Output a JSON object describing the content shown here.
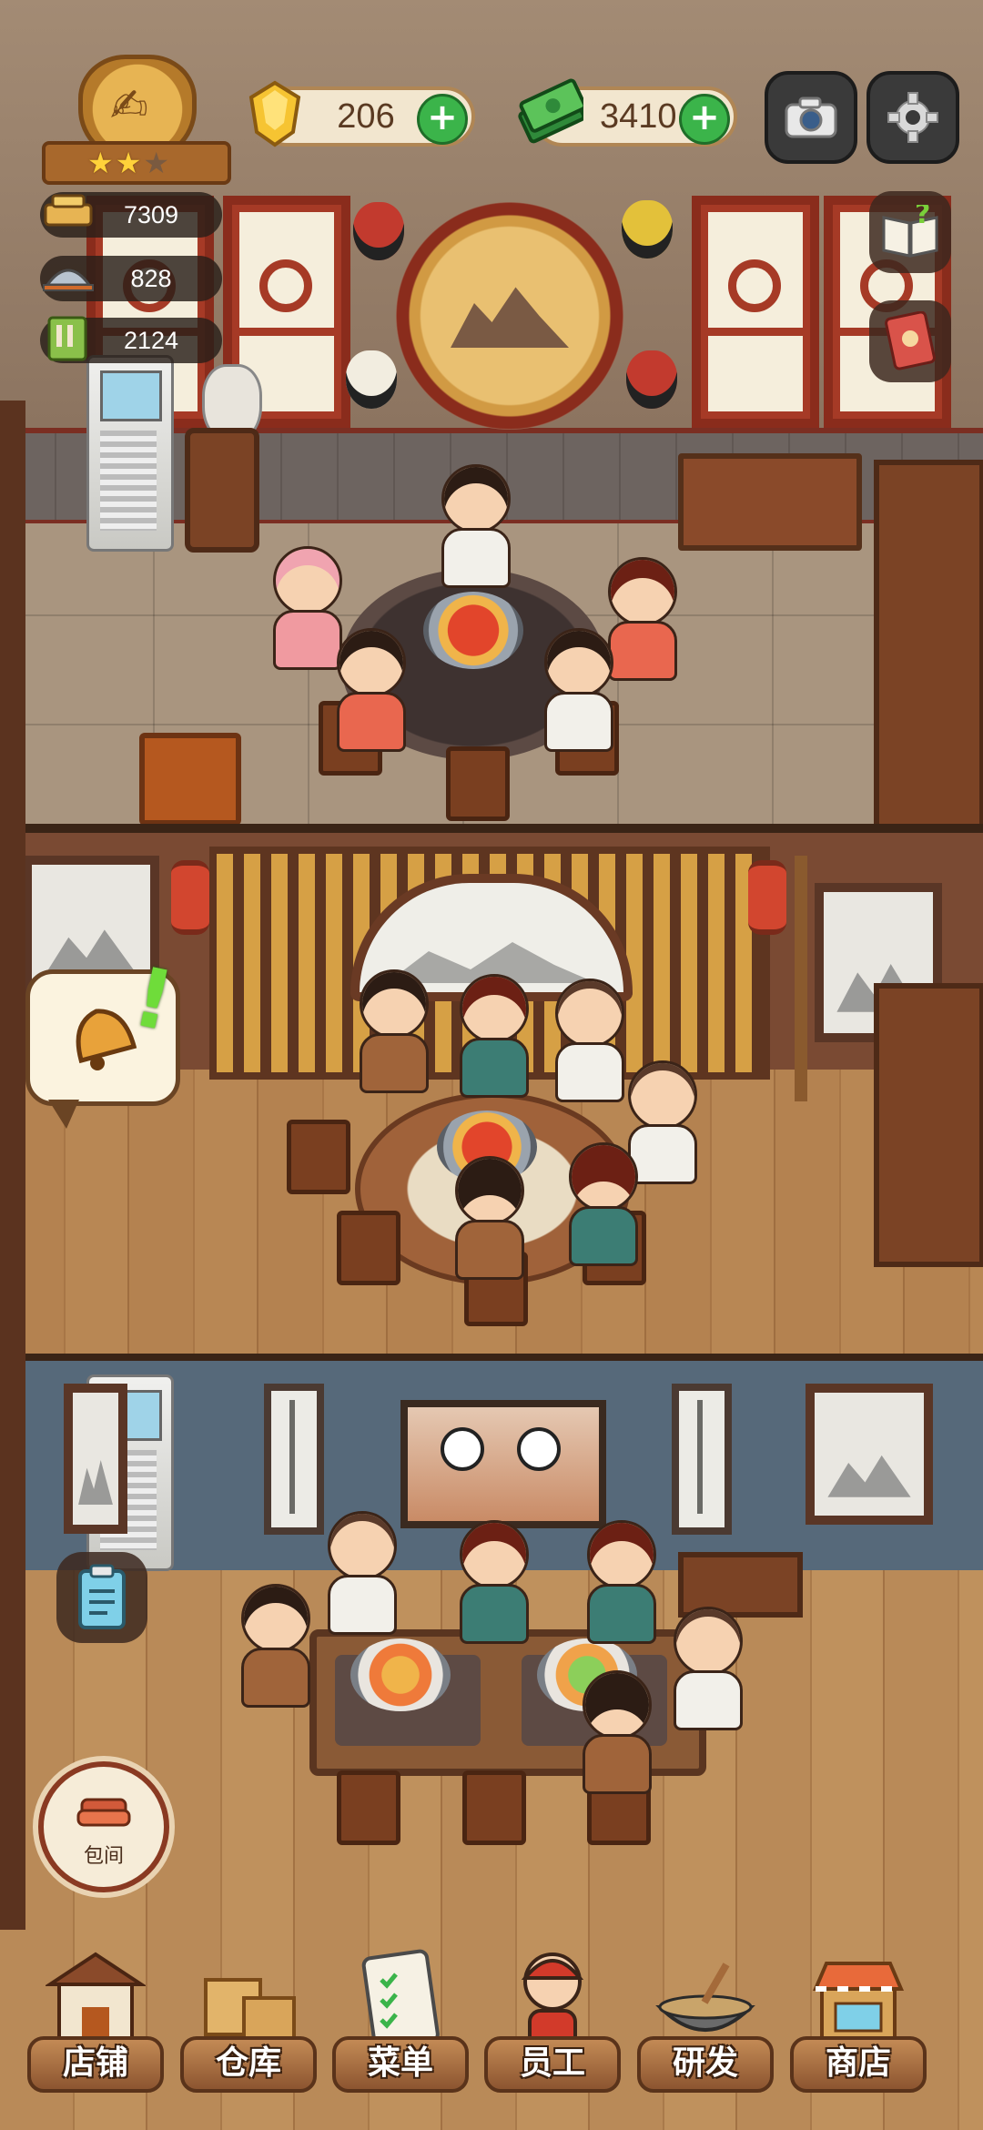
{
  "hud": {
    "stars": {
      "filled": 2,
      "total": 3
    },
    "gems": "206",
    "cash": "3410",
    "plus_symbol": "+",
    "stats": [
      {
        "icon": "bell-pepper-pot-icon",
        "value": "7309"
      },
      {
        "icon": "serving-cloche-icon",
        "value": "828"
      },
      {
        "icon": "recipe-book-icon",
        "value": "2124"
      }
    ]
  },
  "side_buttons": {
    "private_room_label": "包间"
  },
  "bottom_nav": [
    {
      "key": "shop-front",
      "label": "店铺",
      "icon": "storefront-icon"
    },
    {
      "key": "warehouse",
      "label": "仓库",
      "icon": "boxes-icon"
    },
    {
      "key": "menu",
      "label": "菜单",
      "icon": "clipboard-icon"
    },
    {
      "key": "staff",
      "label": "员工",
      "icon": "waitress-icon"
    },
    {
      "key": "research",
      "label": "研发",
      "icon": "wok-icon"
    },
    {
      "key": "store",
      "label": "商店",
      "icon": "market-stall-icon"
    }
  ],
  "colors": {
    "plus_green": "#3bb44a",
    "accent_red": "#8a2c1c",
    "wood": "#b48250"
  }
}
